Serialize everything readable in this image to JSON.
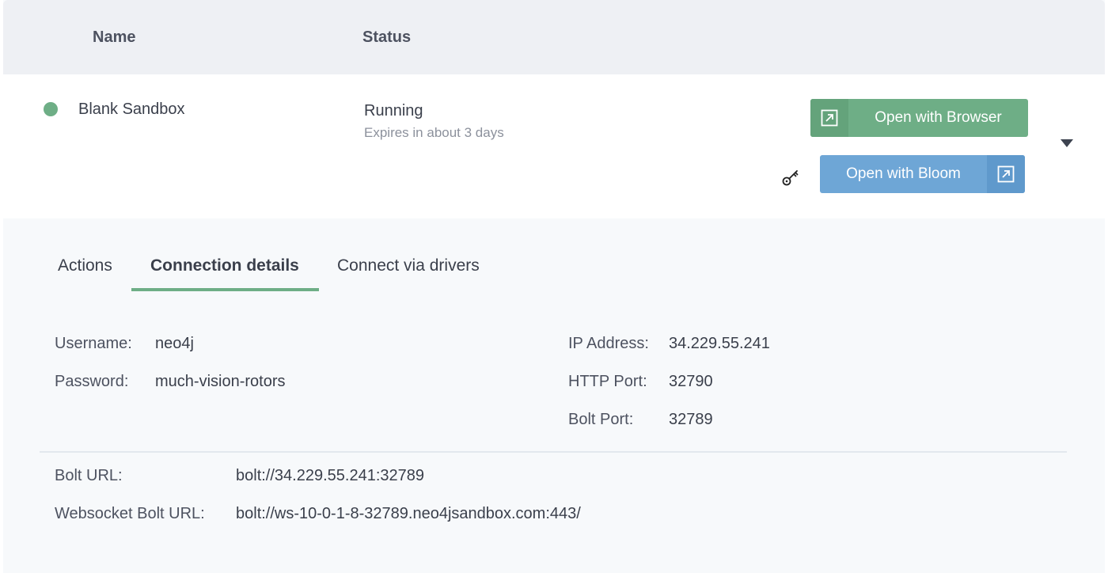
{
  "table": {
    "headers": {
      "name": "Name",
      "status": "Status"
    }
  },
  "sandbox": {
    "name": "Blank Sandbox",
    "status": "Running",
    "expires": "Expires in about 3 days",
    "status_color": "#6eae86"
  },
  "buttons": {
    "open_browser": "Open with Browser",
    "open_bloom": "Open with Bloom",
    "browser_color": "#6eae86",
    "bloom_color": "#6ea6d6"
  },
  "icons": {
    "external_link": "external-link-icon",
    "key": "key-icon",
    "caret": "caret-down-icon"
  },
  "tabs": [
    {
      "label": "Actions",
      "active": false
    },
    {
      "label": "Connection details",
      "active": true
    },
    {
      "label": "Connect via drivers",
      "active": false
    }
  ],
  "connection": {
    "username_label": "Username:",
    "username": "neo4j",
    "password_label": "Password:",
    "password": "much-vision-rotors",
    "ip_label": "IP Address:",
    "ip": "34.229.55.241",
    "http_port_label": "HTTP Port:",
    "http_port": "32790",
    "bolt_port_label": "Bolt Port:",
    "bolt_port": "32789",
    "bolt_url_label": "Bolt URL:",
    "bolt_url": "bolt://34.229.55.241:32789",
    "ws_url_label": "Websocket Bolt URL:",
    "ws_url": "bolt://ws-10-0-1-8-32789.neo4jsandbox.com:443/"
  }
}
